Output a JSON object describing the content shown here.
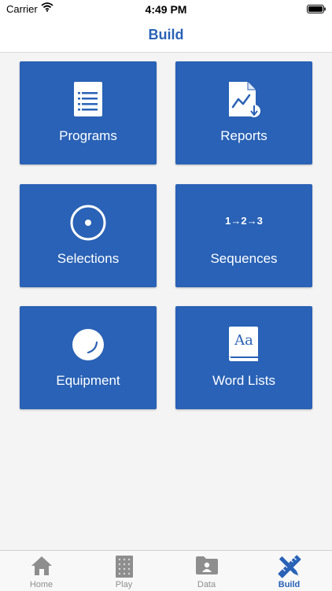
{
  "status_bar": {
    "carrier": "Carrier",
    "time": "4:49 PM"
  },
  "header": {
    "title": "Build"
  },
  "tiles": [
    {
      "label": "Programs",
      "icon": "document-list-icon"
    },
    {
      "label": "Reports",
      "icon": "report-chart-icon"
    },
    {
      "label": "Selections",
      "icon": "target-circle-icon"
    },
    {
      "label": "Sequences",
      "icon": "sequence-123-icon",
      "icon_text": "1→2→3"
    },
    {
      "label": "Equipment",
      "icon": "ball-icon"
    },
    {
      "label": "Word Lists",
      "icon": "book-aa-icon",
      "icon_text": "Aa"
    }
  ],
  "tab_bar": {
    "tabs": [
      {
        "label": "Home",
        "icon": "home-icon",
        "active": false
      },
      {
        "label": "Play",
        "icon": "play-board-icon",
        "active": false
      },
      {
        "label": "Data",
        "icon": "data-folder-icon",
        "active": false
      },
      {
        "label": "Build",
        "icon": "build-tools-icon",
        "active": true
      }
    ]
  },
  "colors": {
    "accent": "#2962b6",
    "tile_bg": "#2962b6",
    "title": "#2962b6",
    "tab_inactive": "#8e8e8e",
    "background": "#f4f4f4"
  }
}
